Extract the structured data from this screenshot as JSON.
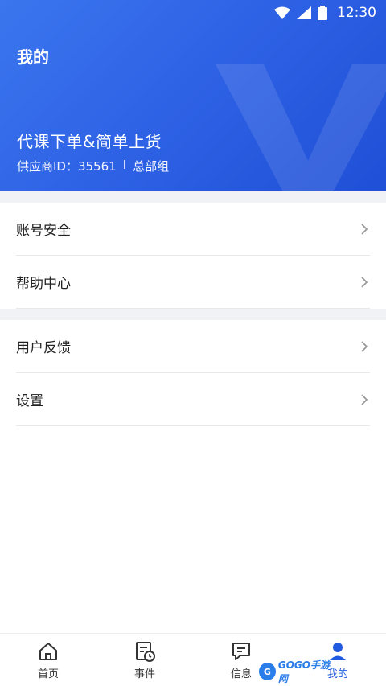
{
  "status_bar": {
    "time": "12:30"
  },
  "header": {
    "title": "我的",
    "store_name": "代课下单&简单上货",
    "supplier_id_label": "供应商ID：35561",
    "separator": "I",
    "org": "总部组"
  },
  "menu": {
    "group1": [
      {
        "label": "账号安全"
      },
      {
        "label": "帮助中心"
      }
    ],
    "group2": [
      {
        "label": "用户反馈"
      },
      {
        "label": "设置"
      }
    ]
  },
  "tabbar": {
    "items": [
      {
        "label": "首页",
        "icon": "home-icon"
      },
      {
        "label": "事件",
        "icon": "event-clock-icon"
      },
      {
        "label": "信息",
        "icon": "message-icon"
      },
      {
        "label": "我的",
        "icon": "profile-icon"
      }
    ],
    "active_index": 3
  },
  "watermark": {
    "text": "GOGO手游网"
  },
  "colors": {
    "primary": "#2f63e6",
    "active_tab": "#1f5ae0",
    "separator": "#f1f2f5"
  }
}
